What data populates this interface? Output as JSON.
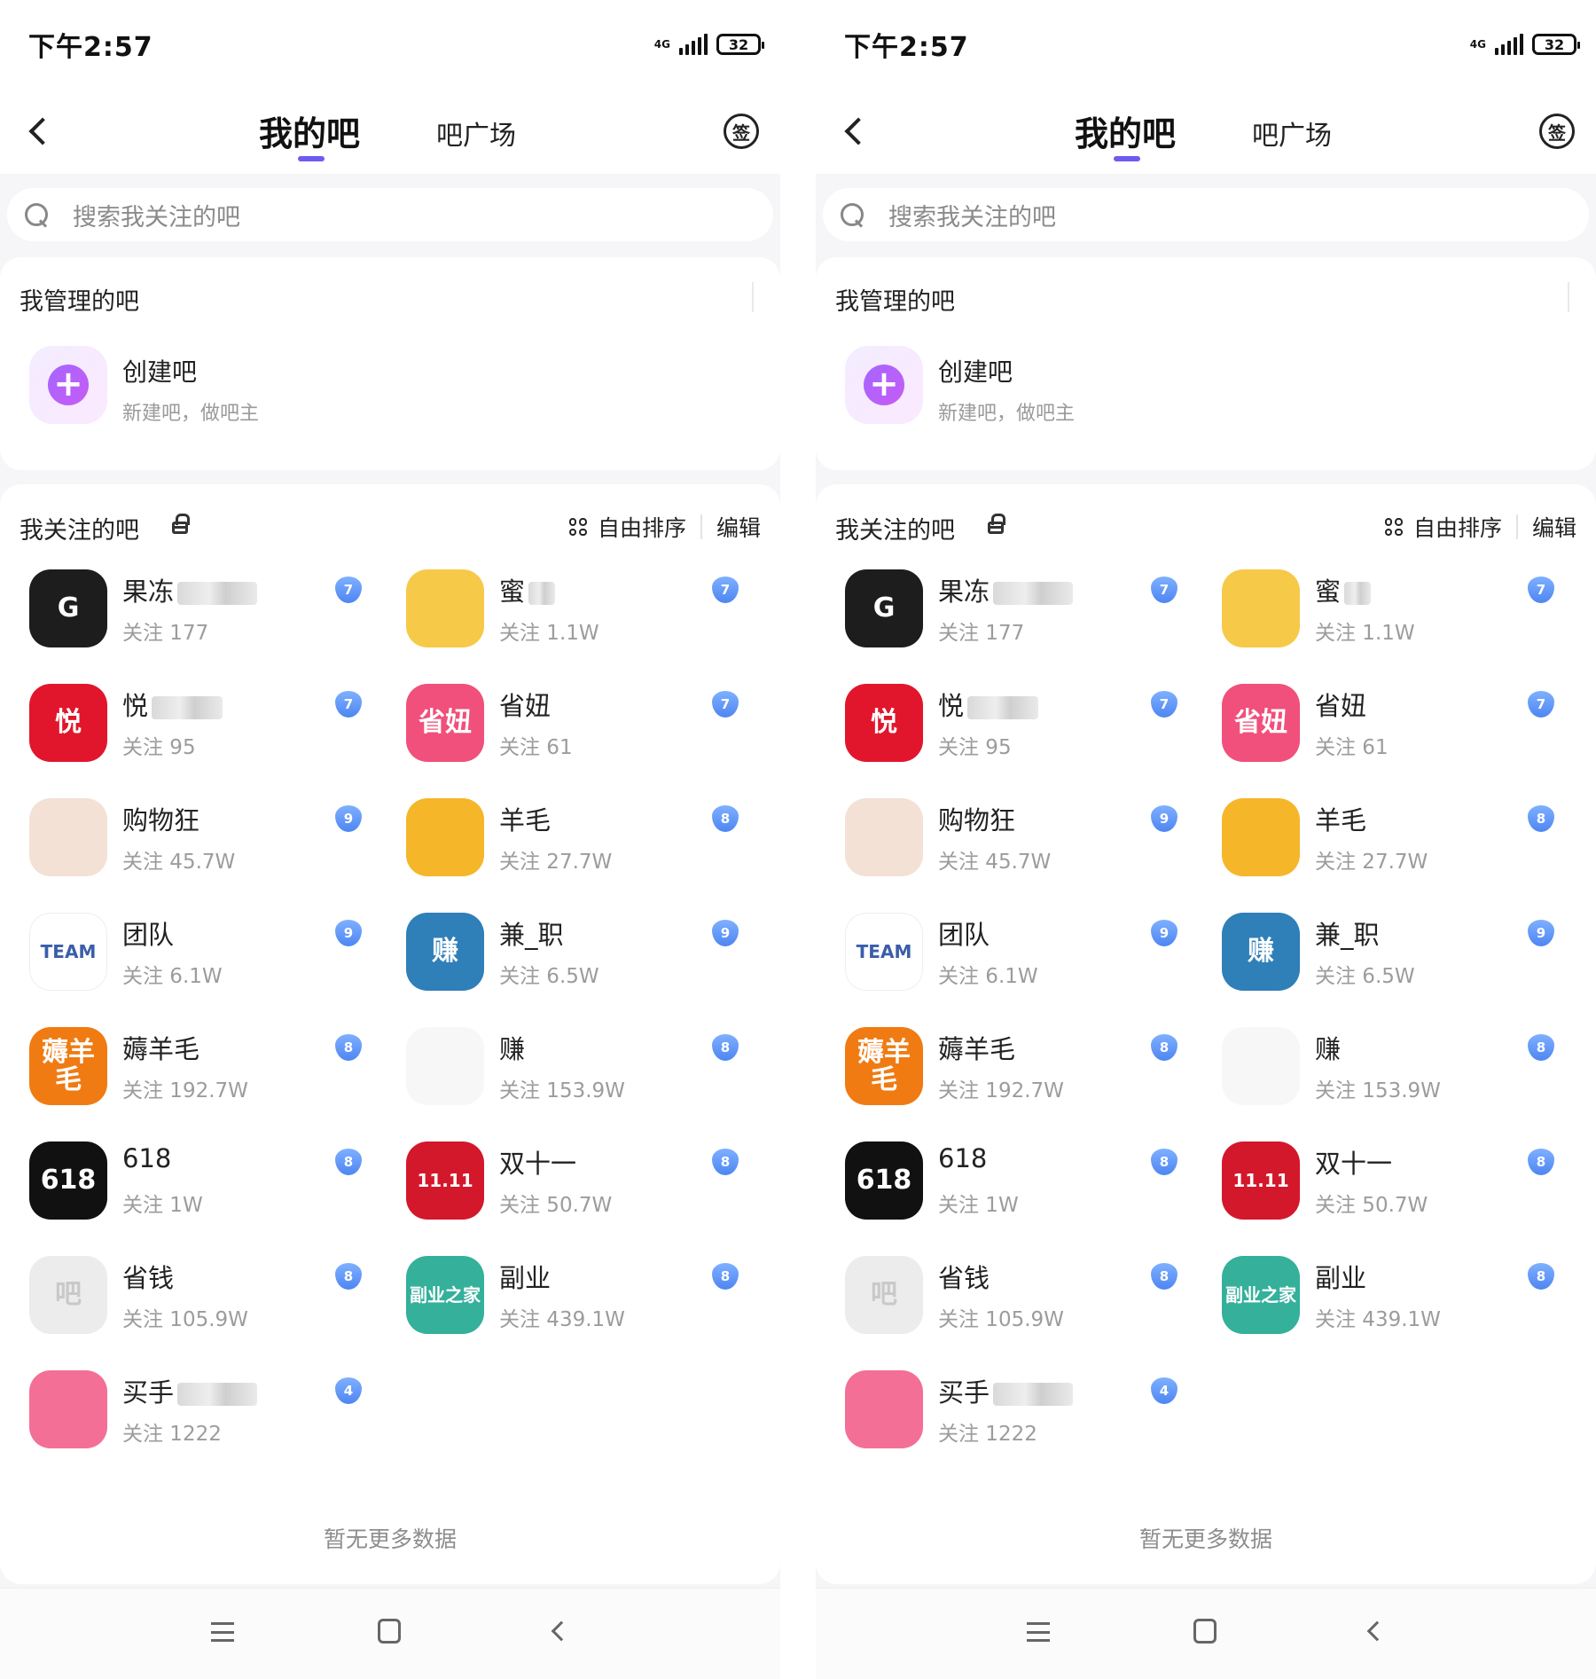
{
  "status_bar": {
    "time": "下午2:57",
    "network": "4G",
    "battery": "32"
  },
  "nav": {
    "active_tab": "我的吧",
    "other_tab": "吧广场",
    "sign_icon_label": "签"
  },
  "search": {
    "placeholder": "搜索我关注的吧"
  },
  "managed": {
    "title": "我管理的吧",
    "create_title": "创建吧",
    "create_subtitle": "新建吧，做吧主"
  },
  "followed": {
    "title": "我关注的吧",
    "sort_label": "自由排序",
    "edit_label": "编辑",
    "forums": [
      {
        "name": "果冻",
        "follow": "关注 177",
        "level": "7",
        "avatar_text": "G",
        "bg": "#1d1d1d"
      },
      {
        "name": "蜜",
        "follow": "关注 1.1W",
        "level": "7",
        "avatar_text": "",
        "bg": "#f7c948"
      },
      {
        "name": "悦",
        "follow": "关注 95",
        "level": "7",
        "avatar_text": "悦",
        "bg": "#e1162c"
      },
      {
        "name": "省妞",
        "follow": "关注 61",
        "level": "7",
        "avatar_text": "省妞",
        "bg": "#f0507b"
      },
      {
        "name": "购物狂",
        "follow": "关注 45.7W",
        "level": "9",
        "avatar_text": "",
        "bg": "#f3e1d5"
      },
      {
        "name": "羊毛",
        "follow": "关注 27.7W",
        "level": "8",
        "avatar_text": "",
        "bg": "#f6b62a"
      },
      {
        "name": "团队",
        "follow": "关注 6.1W",
        "level": "9",
        "avatar_text": "TEAM",
        "bg": "#ffffff"
      },
      {
        "name": "兼_职",
        "follow": "关注 6.5W",
        "level": "9",
        "avatar_text": "赚",
        "bg": "#2f7fb8"
      },
      {
        "name": "薅羊毛",
        "follow": "关注 192.7W",
        "level": "8",
        "avatar_text": "薅羊毛",
        "bg": "#f07b13"
      },
      {
        "name": "赚",
        "follow": "关注 153.9W",
        "level": "8",
        "avatar_text": "",
        "bg": "#f7f7f7"
      },
      {
        "name": "618",
        "follow": "关注 1W",
        "level": "8",
        "avatar_text": "618",
        "bg": "#111111"
      },
      {
        "name": "双十一",
        "follow": "关注 50.7W",
        "level": "8",
        "avatar_text": "11.11",
        "bg": "#d3182b"
      },
      {
        "name": "省钱",
        "follow": "关注 105.9W",
        "level": "8",
        "avatar_text": "吧",
        "bg": "#ececec"
      },
      {
        "name": "副业",
        "follow": "关注 439.1W",
        "level": "8",
        "avatar_text": "副业之家",
        "bg": "#34b09b"
      },
      {
        "name": "买手",
        "follow": "关注 1222",
        "level": "4",
        "avatar_text": "",
        "bg": "#f36f96"
      }
    ],
    "no_more": "暂无更多数据"
  },
  "colors": {
    "accent": "#6e5bf2",
    "badge": "#5a8ff5",
    "create_plus": "#b55ff8"
  }
}
